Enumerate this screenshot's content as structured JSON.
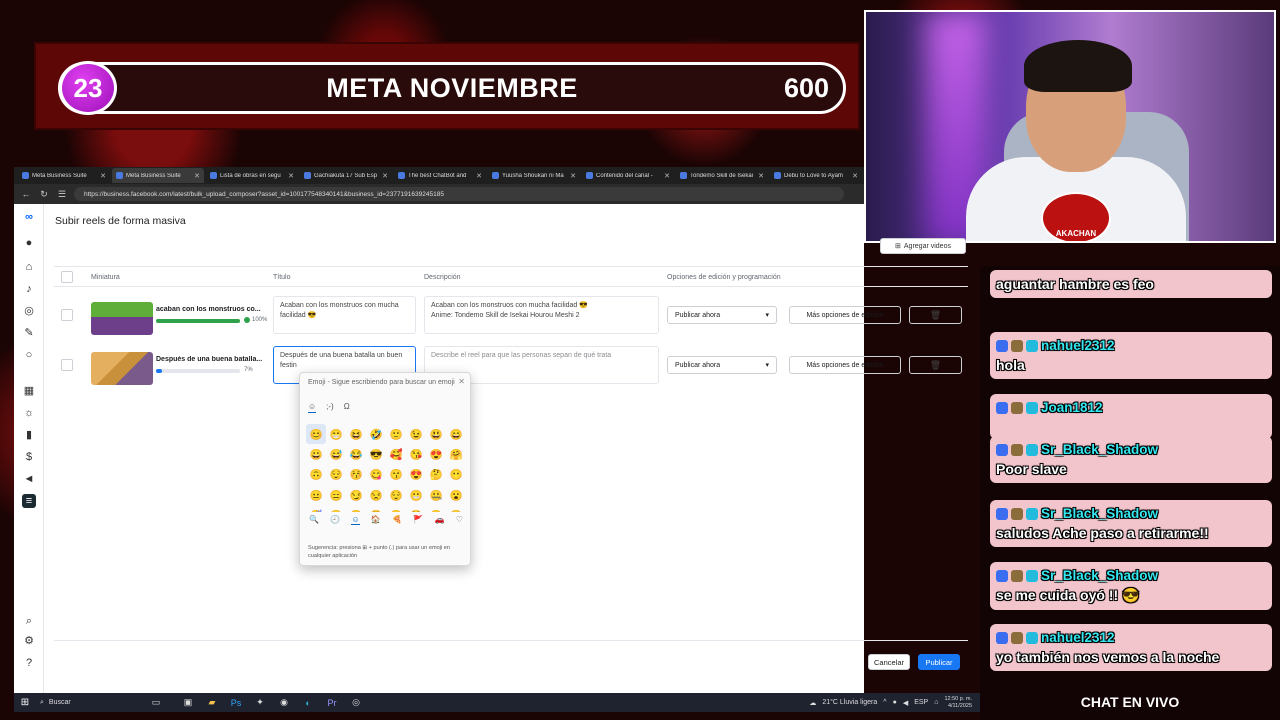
{
  "overlay": {
    "meta_number": "23",
    "meta_title": "META NOVIEMBRE",
    "meta_goal": "600",
    "webcam_logo": "AKACHAN",
    "chat_title": "CHAT EN VIVO"
  },
  "browser": {
    "tabs": [
      {
        "label": "Meta Business Suite",
        "active": false
      },
      {
        "label": "Meta Business Suite",
        "active": true
      },
      {
        "label": "Lista de obras en segu",
        "active": false
      },
      {
        "label": "Gachiakuta 17 Sub Esp",
        "active": false
      },
      {
        "label": "The best ChatBot and",
        "active": false
      },
      {
        "label": "Yuusha Shoukan ni Ma",
        "active": false
      },
      {
        "label": "Contenido del canal -",
        "active": false
      },
      {
        "label": "Tondemo Skill de Isekai",
        "active": false
      },
      {
        "label": "Debu to Love to Ayam",
        "active": false
      }
    ],
    "url": "https://business.facebook.com/latest/bulk_upload_composer?asset_id=100177548340141&business_id=2377191639245185"
  },
  "page": {
    "title": "Subir reels de forma masiva",
    "add_videos": "Agregar videos",
    "columns": {
      "thumbnail": "Miniatura",
      "title": "Título",
      "description": "Descripción",
      "options": "Opciones de edición y programación"
    },
    "rows": [
      {
        "name": "acaban con los monstruos co...",
        "progress": 100,
        "progress_label": "100%",
        "title": "Acaban con los monstruos con mucha facilidad 😎",
        "description_line1": "Acaban con los monstruos con mucha facilidad 😎",
        "description_line2": "Anime: Tondemo Skill de Isekai Hourou Meshi 2",
        "schedule": "Publicar ahora",
        "more_options": "Más opciones de edición"
      },
      {
        "name": "Después de una buena batalla...",
        "progress": 7,
        "progress_label": "7%",
        "title": "Después de una buena batalla un buen festin",
        "description_placeholder": "Describe el reel para que las personas sepan de qué trata",
        "schedule": "Publicar ahora",
        "more_options": "Más opciones de edición"
      }
    ],
    "cancel": "Cancelar",
    "publish": "Publicar"
  },
  "emoji_picker": {
    "header": "Emoji - Sigue escribiendo para buscar un emoji",
    "tabs": [
      "☺",
      ";-)",
      "Ω"
    ],
    "emojis": [
      "😊",
      "😁",
      "😆",
      "🤣",
      "🙂",
      "😉",
      "😃",
      "😄",
      "😀",
      "😅",
      "😂",
      "😎",
      "🥰",
      "😘",
      "😍",
      "🤗",
      "🙃",
      "😌",
      "😚",
      "😋",
      "😙",
      "😍",
      "🤔",
      "😶",
      "😐",
      "😑",
      "😏",
      "😒",
      "😌",
      "😬",
      "🤐",
      "😮",
      "😴",
      "😪",
      "😯",
      "😫",
      "😷",
      "😵",
      "😕",
      "😟"
    ],
    "bottom_icons": [
      "🔍",
      "🕘",
      "☺",
      "🏠",
      "🍕",
      "🚩",
      "🚗",
      "♡"
    ],
    "hint": "Sugerencia: presiona ⊞ + punto (.) para usar un emoji en cualquier aplicación"
  },
  "taskbar": {
    "search": "Buscar",
    "weather": "21°C  Lluvia ligera",
    "lang": "ESP",
    "time": "12:50 p. m.",
    "date": "4/11/2025"
  },
  "chat": {
    "messages": [
      {
        "user": "",
        "text": "aguantar hambre es feo"
      },
      {
        "user": "nahuel2312",
        "text": "hola"
      },
      {
        "user": "Joan1812",
        "text": ""
      },
      {
        "user": "Sr_Black_Shadow",
        "text": "Poor slave"
      },
      {
        "user": "Sr_Black_Shadow",
        "text": "saludos Ache paso a retirarme!!"
      },
      {
        "user": "Sr_Black_Shadow",
        "text": "se me cuida oyó !! 😎"
      },
      {
        "user": "nahuel2312",
        "text": "yo también nos vemos a la noche"
      }
    ]
  }
}
